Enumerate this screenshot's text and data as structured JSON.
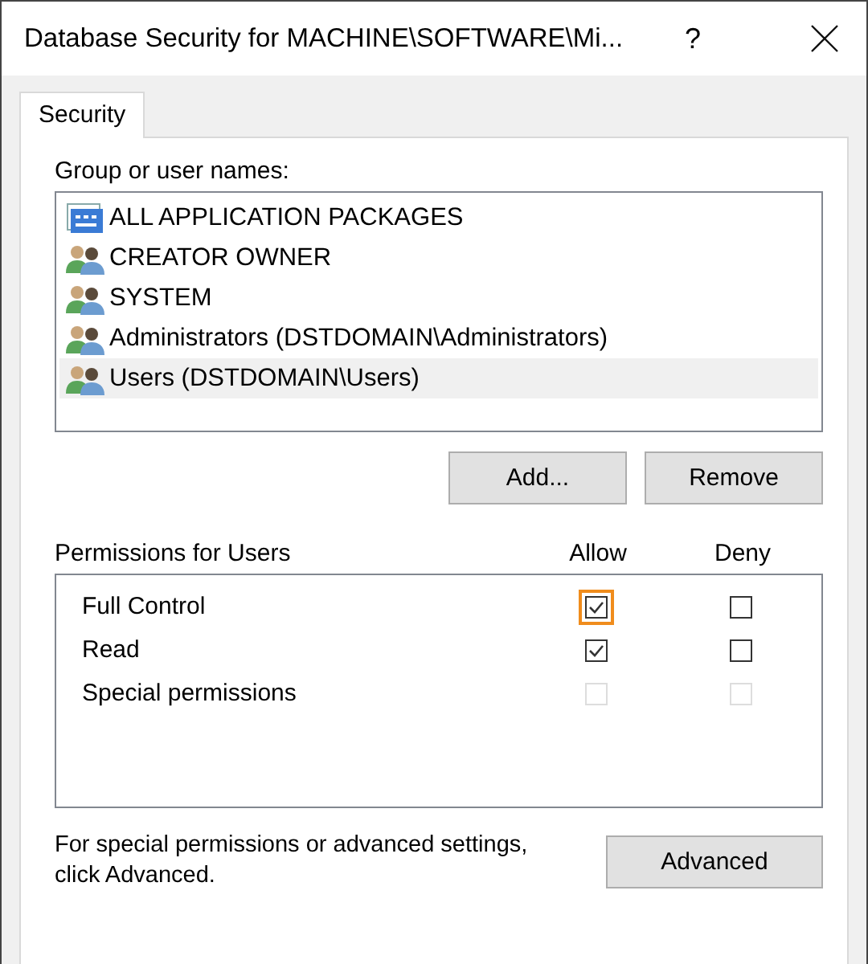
{
  "window": {
    "title": "Database Security for MACHINE\\SOFTWARE\\Mi...",
    "help_button": "?"
  },
  "tabs": [
    {
      "label": "Security",
      "selected": true
    }
  ],
  "group_label": "Group or user names:",
  "principals": [
    {
      "name": "ALL APPLICATION PACKAGES",
      "kind": "package",
      "selected": false
    },
    {
      "name": "CREATOR OWNER",
      "kind": "group",
      "selected": false
    },
    {
      "name": "SYSTEM",
      "kind": "group",
      "selected": false
    },
    {
      "name": "Administrators (DSTDOMAIN\\Administrators)",
      "kind": "group",
      "selected": false
    },
    {
      "name": "Users (DSTDOMAIN\\Users)",
      "kind": "group",
      "selected": true
    }
  ],
  "principal_buttons": [
    "Add...",
    "Remove"
  ],
  "permissions": {
    "title": "Permissions for Users",
    "columns": [
      "Allow",
      "Deny"
    ],
    "rows": [
      {
        "name": "Full Control",
        "allow": {
          "checked": true,
          "disabled": false,
          "highlighted": true
        },
        "deny": {
          "checked": false,
          "disabled": false,
          "highlighted": false
        }
      },
      {
        "name": "Read",
        "allow": {
          "checked": true,
          "disabled": false,
          "highlighted": false
        },
        "deny": {
          "checked": false,
          "disabled": false,
          "highlighted": false
        }
      },
      {
        "name": "Special permissions",
        "allow": {
          "checked": false,
          "disabled": true,
          "highlighted": false
        },
        "deny": {
          "checked": false,
          "disabled": true,
          "highlighted": false
        }
      }
    ]
  },
  "advanced": {
    "note": "For special permissions or advanced settings, click Advanced.",
    "button": "Advanced"
  }
}
